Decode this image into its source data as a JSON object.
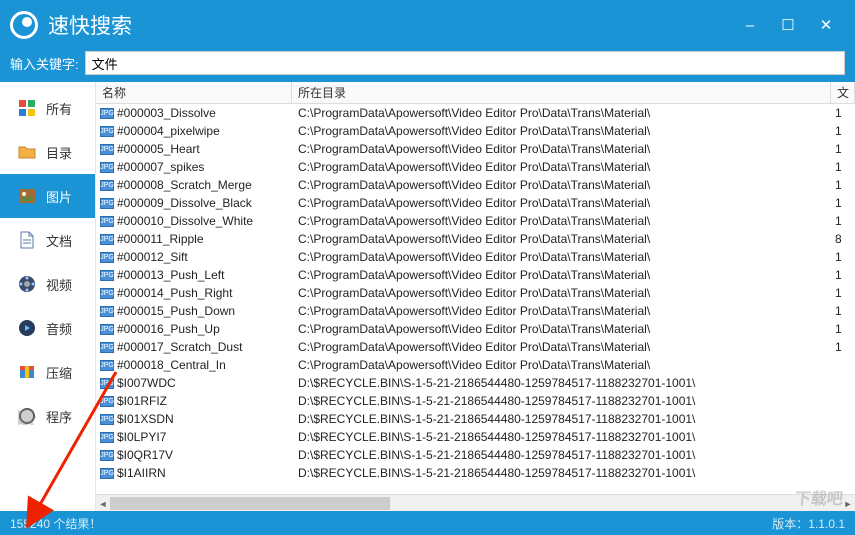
{
  "window": {
    "title": "速快搜索",
    "min_label": "–",
    "max_label": "☐",
    "close_label": "✕"
  },
  "search": {
    "label": "输入关键字:",
    "value": "文件"
  },
  "sidebar": {
    "items": [
      {
        "label": "所有",
        "icon": "all-icon"
      },
      {
        "label": "目录",
        "icon": "folder-icon"
      },
      {
        "label": "图片",
        "icon": "image-icon",
        "active": true
      },
      {
        "label": "文档",
        "icon": "document-icon"
      },
      {
        "label": "视频",
        "icon": "video-icon"
      },
      {
        "label": "音频",
        "icon": "audio-icon"
      },
      {
        "label": "压缩",
        "icon": "archive-icon"
      },
      {
        "label": "程序",
        "icon": "program-icon"
      }
    ]
  },
  "table": {
    "headers": {
      "name": "名称",
      "path": "所在目录",
      "ext": "文"
    },
    "rows": [
      {
        "name": "#000003_Dissolve",
        "path": "C:\\ProgramData\\Apowersoft\\Video Editor Pro\\Data\\Trans\\Material\\",
        "ext": "1"
      },
      {
        "name": "#000004_pixelwipe",
        "path": "C:\\ProgramData\\Apowersoft\\Video Editor Pro\\Data\\Trans\\Material\\",
        "ext": "1"
      },
      {
        "name": "#000005_Heart",
        "path": "C:\\ProgramData\\Apowersoft\\Video Editor Pro\\Data\\Trans\\Material\\",
        "ext": "1"
      },
      {
        "name": "#000007_spikes",
        "path": "C:\\ProgramData\\Apowersoft\\Video Editor Pro\\Data\\Trans\\Material\\",
        "ext": "1"
      },
      {
        "name": "#000008_Scratch_Merge",
        "path": "C:\\ProgramData\\Apowersoft\\Video Editor Pro\\Data\\Trans\\Material\\",
        "ext": "1"
      },
      {
        "name": "#000009_Dissolve_Black",
        "path": "C:\\ProgramData\\Apowersoft\\Video Editor Pro\\Data\\Trans\\Material\\",
        "ext": "1"
      },
      {
        "name": "#000010_Dissolve_White",
        "path": "C:\\ProgramData\\Apowersoft\\Video Editor Pro\\Data\\Trans\\Material\\",
        "ext": "1"
      },
      {
        "name": "#000011_Ripple",
        "path": "C:\\ProgramData\\Apowersoft\\Video Editor Pro\\Data\\Trans\\Material\\",
        "ext": "8"
      },
      {
        "name": "#000012_Sift",
        "path": "C:\\ProgramData\\Apowersoft\\Video Editor Pro\\Data\\Trans\\Material\\",
        "ext": "1"
      },
      {
        "name": "#000013_Push_Left",
        "path": "C:\\ProgramData\\Apowersoft\\Video Editor Pro\\Data\\Trans\\Material\\",
        "ext": "1"
      },
      {
        "name": "#000014_Push_Right",
        "path": "C:\\ProgramData\\Apowersoft\\Video Editor Pro\\Data\\Trans\\Material\\",
        "ext": "1"
      },
      {
        "name": "#000015_Push_Down",
        "path": "C:\\ProgramData\\Apowersoft\\Video Editor Pro\\Data\\Trans\\Material\\",
        "ext": "1"
      },
      {
        "name": "#000016_Push_Up",
        "path": "C:\\ProgramData\\Apowersoft\\Video Editor Pro\\Data\\Trans\\Material\\",
        "ext": "1"
      },
      {
        "name": "#000017_Scratch_Dust",
        "path": "C:\\ProgramData\\Apowersoft\\Video Editor Pro\\Data\\Trans\\Material\\",
        "ext": "1"
      },
      {
        "name": "#000018_Central_In",
        "path": "C:\\ProgramData\\Apowersoft\\Video Editor Pro\\Data\\Trans\\Material\\",
        "ext": ""
      },
      {
        "name": "$I007WDC",
        "path": "D:\\$RECYCLE.BIN\\S-1-5-21-2186544480-1259784517-1188232701-1001\\",
        "ext": ""
      },
      {
        "name": "$I01RFIZ",
        "path": "D:\\$RECYCLE.BIN\\S-1-5-21-2186544480-1259784517-1188232701-1001\\",
        "ext": ""
      },
      {
        "name": "$I01XSDN",
        "path": "D:\\$RECYCLE.BIN\\S-1-5-21-2186544480-1259784517-1188232701-1001\\",
        "ext": ""
      },
      {
        "name": "$I0LPYI7",
        "path": "D:\\$RECYCLE.BIN\\S-1-5-21-2186544480-1259784517-1188232701-1001\\",
        "ext": ""
      },
      {
        "name": "$I0QR17V",
        "path": "D:\\$RECYCLE.BIN\\S-1-5-21-2186544480-1259784517-1188232701-1001\\",
        "ext": ""
      },
      {
        "name": "$I1AIIRN",
        "path": "D:\\$RECYCLE.BIN\\S-1-5-21-2186544480-1259784517-1188232701-1001\\",
        "ext": ""
      }
    ],
    "file_icon_label": "JPG"
  },
  "status": {
    "count": "155240",
    "count_suffix": " 个结果！",
    "version_label": "版本：",
    "version": "1.1.0.1"
  },
  "watermark": "下载吧"
}
